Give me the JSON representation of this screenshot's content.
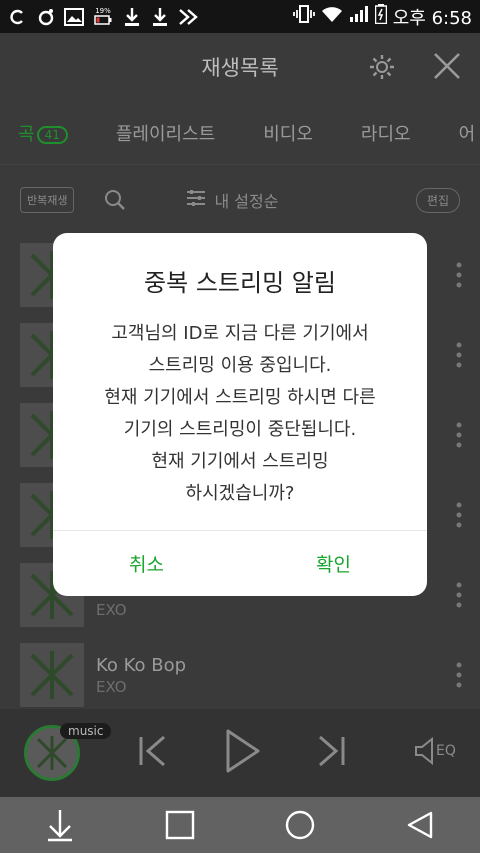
{
  "status_bar": {
    "battery_small": "19%",
    "time": "오후 6:58"
  },
  "header": {
    "title": "재생목록"
  },
  "tabs": [
    {
      "label": "곡",
      "count": "41"
    },
    {
      "label": "플레이리스트"
    },
    {
      "label": "비디오"
    },
    {
      "label": "라디오"
    },
    {
      "label": "어"
    }
  ],
  "toolbar": {
    "repeat_label": "반복재생",
    "sort_label": "내 설정순",
    "edit_label": "편집"
  },
  "tracks": [
    {
      "title": "",
      "artist": ""
    },
    {
      "title": "",
      "artist": ""
    },
    {
      "title": "",
      "artist": ""
    },
    {
      "title": "",
      "artist": ""
    },
    {
      "title": "",
      "artist": "EXO"
    },
    {
      "title": "Ko Ko Bop",
      "artist": "EXO"
    }
  ],
  "player": {
    "badge": "music",
    "eq_label": "EQ"
  },
  "dialog": {
    "title": "중복 스트리밍 알림",
    "lines": [
      "고객님의 ID로 지금 다른 기기에서",
      "스트리밍 이용 중입니다.",
      "현재 기기에서 스트리밍 하시면 다른",
      "기기의 스트리밍이 중단됩니다.",
      "현재 기기에서 스트리밍",
      "하시겠습니까?"
    ],
    "cancel_label": "취소",
    "confirm_label": "확인"
  },
  "colors": {
    "accent": "#1aa52f",
    "dim_overlay": "#3a3a3a"
  }
}
